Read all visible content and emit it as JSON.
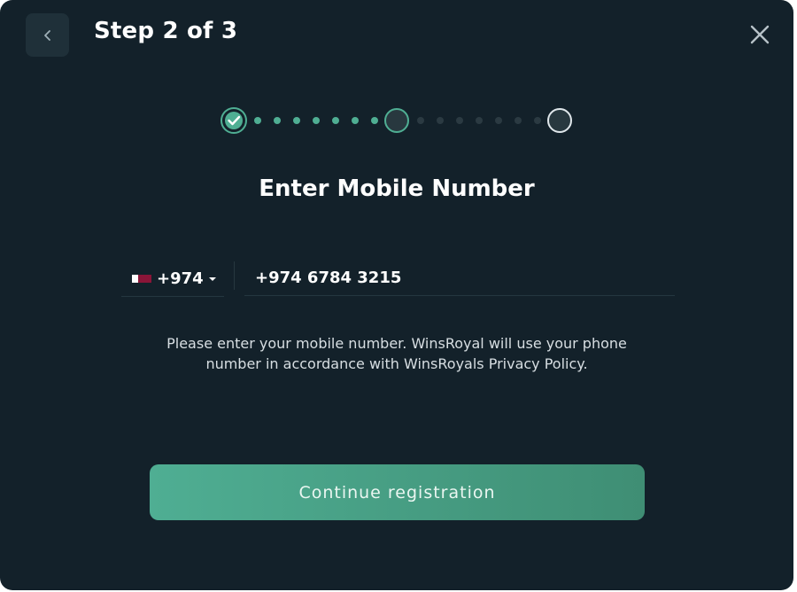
{
  "header": {
    "step_title": "Step 2 of 3"
  },
  "stepper": {
    "current_step": 2,
    "total_steps": 3,
    "completed_color": "#4fae93",
    "pending_color": "#2b3a42"
  },
  "main": {
    "heading": "Enter Mobile Number",
    "country_code": "+974",
    "phone_value": "+974 6784 3215",
    "info_line1": "Please enter your mobile number. WinsRoyal will use your phone",
    "info_line2": "number in accordance with WinsRoyals Privacy Policy.",
    "continue_label": "Continue registration"
  },
  "icons": {
    "back": "chevron-left-icon",
    "close": "close-icon",
    "check": "check-icon",
    "flag": "qatar-flag-icon",
    "caret": "caret-down-icon"
  }
}
